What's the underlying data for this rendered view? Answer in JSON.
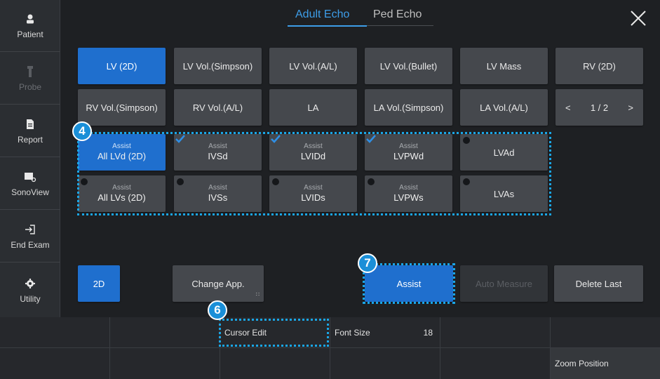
{
  "sidebar": {
    "items": [
      {
        "label": "Patient",
        "icon": "person-icon",
        "enabled": true
      },
      {
        "label": "Probe",
        "icon": "probe-icon",
        "enabled": false
      },
      {
        "label": "Report",
        "icon": "document-icon",
        "enabled": true
      },
      {
        "label": "SonoView",
        "icon": "sonoview-icon",
        "enabled": true
      },
      {
        "label": "End Exam",
        "icon": "exit-icon",
        "enabled": true
      },
      {
        "label": "Utility",
        "icon": "gear-icon",
        "enabled": true
      }
    ]
  },
  "header": {
    "tabs": [
      {
        "label": "Adult Echo",
        "active": true
      },
      {
        "label": "Ped Echo",
        "active": false
      }
    ],
    "close_icon": "close-icon"
  },
  "grid": {
    "row1": [
      "LV (2D)",
      "LV Vol.(Simpson)",
      "LV Vol.(A/L)",
      "LV Vol.(Bullet)",
      "LV Mass",
      "RV (2D)"
    ],
    "row2": [
      "RV Vol.(Simpson)",
      "RV Vol.(A/L)",
      "LA",
      "LA Vol.(Simpson)",
      "LA Vol.(A/L)"
    ],
    "pager": {
      "prev": "<",
      "page": "1 / 2",
      "next": ">"
    },
    "row3": [
      {
        "small": "Assist",
        "big": "All LVd (2D)"
      },
      {
        "small": "Assist",
        "big": "IVSd"
      },
      {
        "small": "Assist",
        "big": "LVIDd"
      },
      {
        "small": "Assist",
        "big": "LVPWd"
      },
      {
        "small": "",
        "big": "LVAd"
      }
    ],
    "row4": [
      {
        "small": "Assist",
        "big": "All LVs (2D)"
      },
      {
        "small": "Assist",
        "big": "IVSs"
      },
      {
        "small": "Assist",
        "big": "LVIDs"
      },
      {
        "small": "Assist",
        "big": "LVPWs"
      },
      {
        "small": "",
        "big": "LVAs"
      }
    ]
  },
  "badges": {
    "four": "4",
    "six": "6",
    "seven": "7"
  },
  "actions": {
    "mode": "2D",
    "change_app": "Change App.",
    "assist": "Assist",
    "auto_measure": "Auto Measure",
    "delete_last": "Delete Last"
  },
  "bottom": {
    "cursor_edit": "Cursor Edit",
    "font_size_label": "Font Size",
    "font_size_value": "18",
    "zoom_position": "Zoom Position"
  },
  "colors": {
    "accent": "#1f6fce",
    "highlight": "#1aa6e6",
    "tab_active": "#3d9de8"
  }
}
